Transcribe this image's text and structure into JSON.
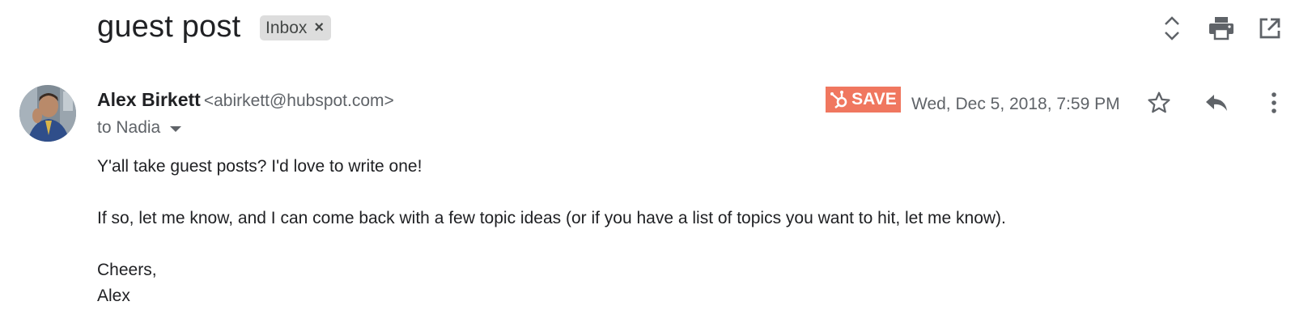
{
  "email": {
    "subject": "guest post",
    "label": "Inbox",
    "label_remove_glyph": "×",
    "sender_name": "Alex Birkett",
    "sender_email": "<abirkett@hubspot.com>",
    "recipients": "to Nadia",
    "save_label": "SAVE",
    "date": "Wed, Dec 5, 2018, 7:59 PM",
    "body": {
      "line1": "Y'all take guest posts? I'd love to write one!",
      "line2": "If so, let me know, and I can come back with a few topic ideas (or if you have a list of topics you want to hit, let me know).",
      "signoff": "Cheers,",
      "signature": "Alex"
    }
  },
  "icons": {
    "expand": "unfold-more-icon",
    "print": "print-icon",
    "open_new_window": "open-in-new-icon",
    "star": "star-outline-icon",
    "reply": "reply-icon",
    "more": "more-vert-icon",
    "hubspot": "hubspot-sprocket-icon"
  },
  "colors": {
    "save_button": "#f0775f",
    "label_chip": "#dddddd",
    "secondary_text": "#5f6368"
  }
}
